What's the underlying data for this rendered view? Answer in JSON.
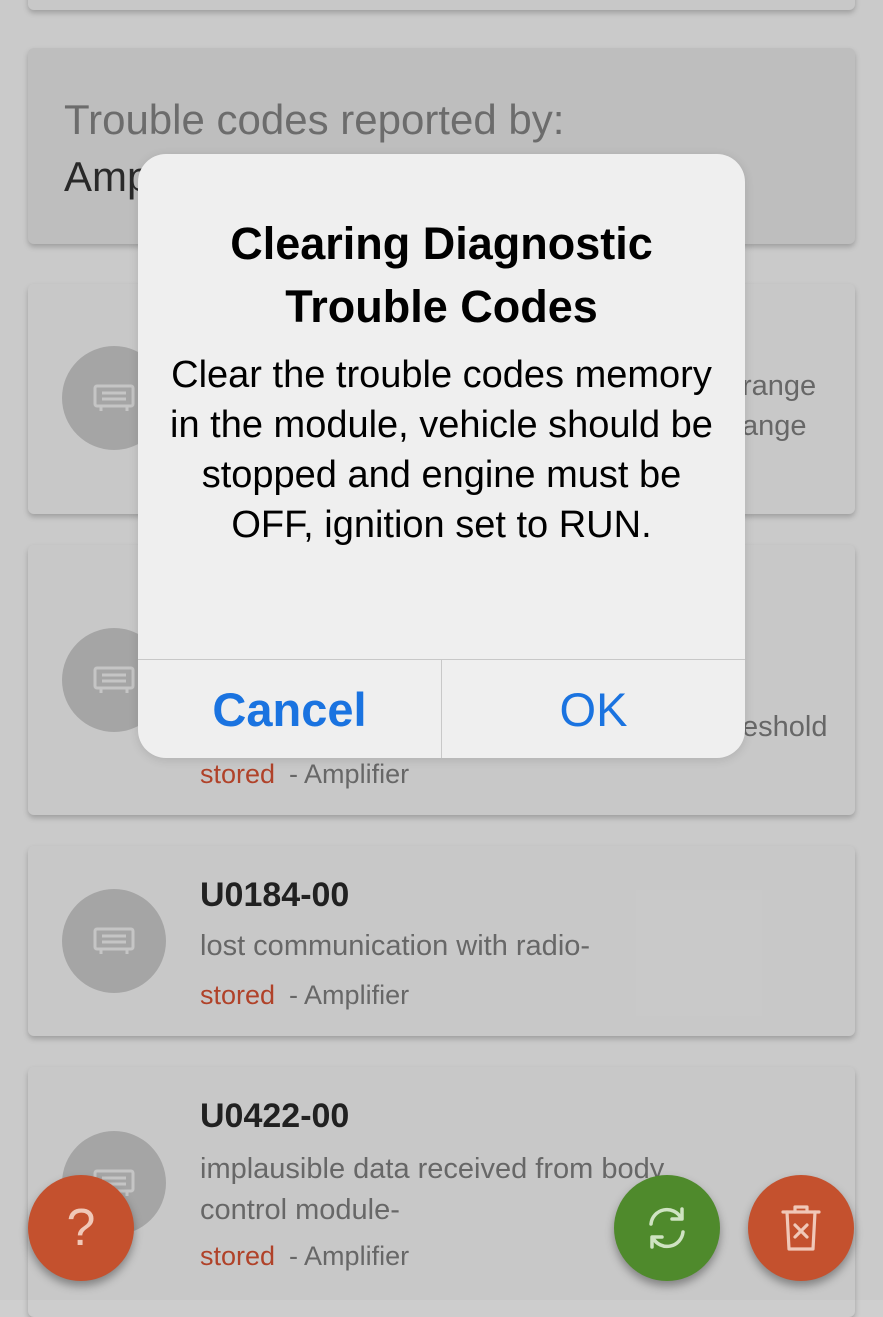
{
  "header": {
    "title": "Trouble codes reported by:",
    "module": "Amplifier"
  },
  "codes": [
    {
      "peek_line1": "range",
      "peek_line2": "ange"
    },
    {
      "peek": "eshold",
      "status": "stored",
      "module": "- Amplifier"
    },
    {
      "code": "U0184-00",
      "description": "lost communication with radio-",
      "status": "stored",
      "module": "- Amplifier"
    },
    {
      "code": "U0422-00",
      "description": "implausible data received from body control module-",
      "status": "stored",
      "module": "- Amplifier"
    }
  ],
  "dialog": {
    "title": "Clearing Diagnostic Trouble Codes",
    "message": "Clear the trouble codes memory in the module, vehicle should be stopped and engine must be OFF, ignition set to RUN.",
    "cancel_label": "Cancel",
    "ok_label": "OK"
  },
  "fabs": {
    "help_label": "?"
  },
  "colors": {
    "accent_blue": "#1a73e0",
    "status_red": "#b4442a",
    "fab_orange": "#c4512e",
    "fab_green": "#4f8a2c"
  }
}
